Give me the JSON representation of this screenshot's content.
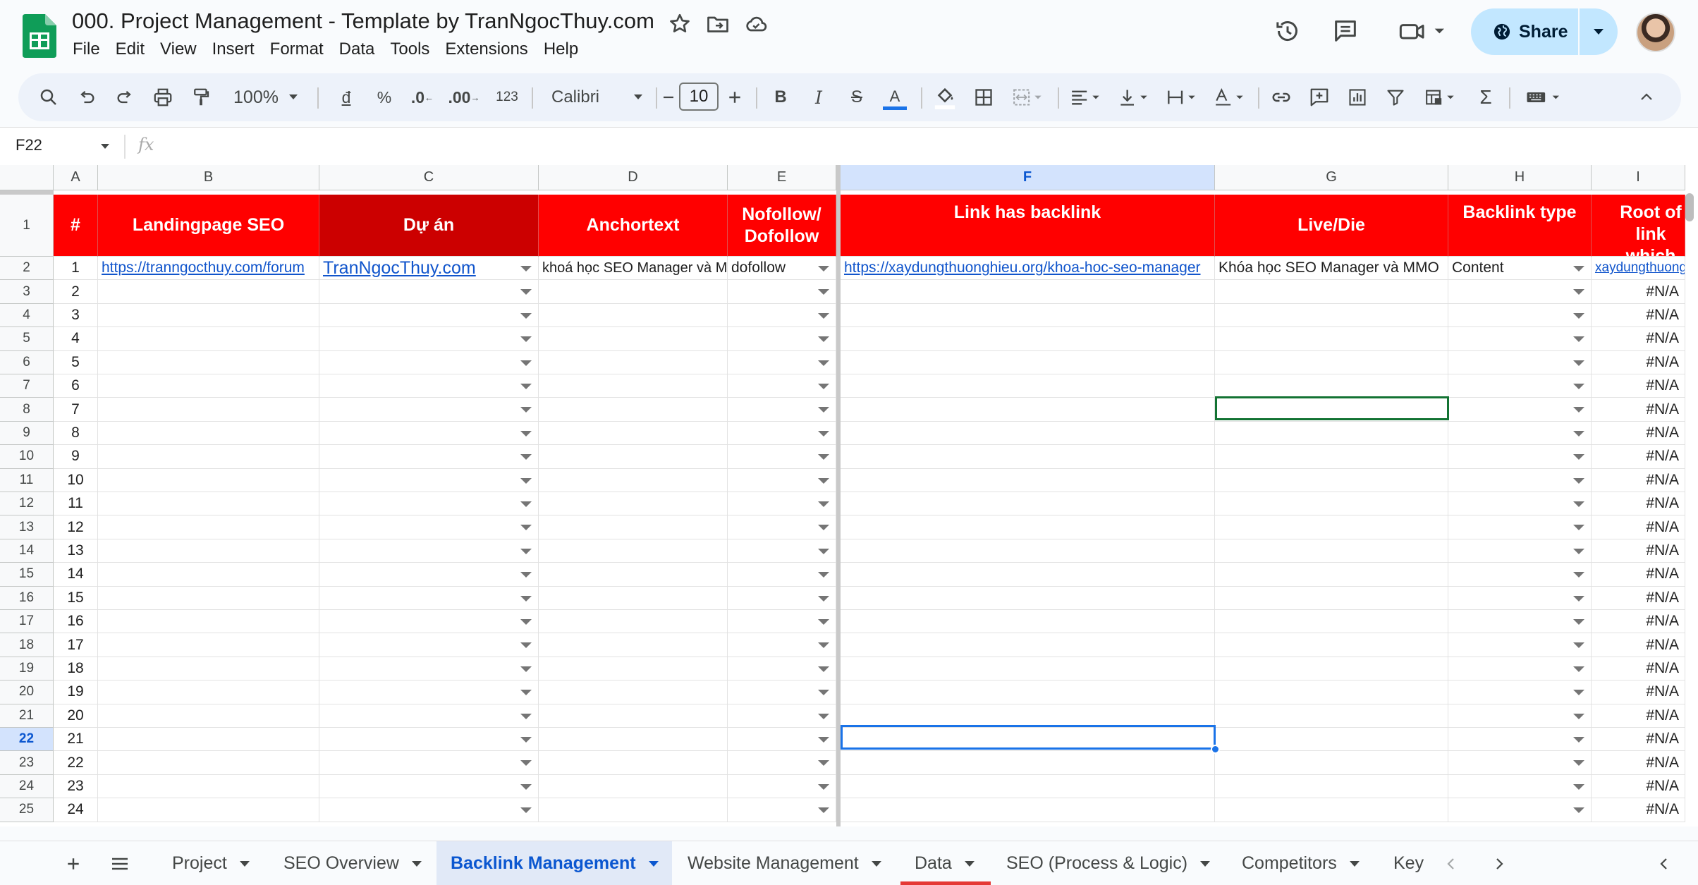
{
  "header": {
    "doc_title": "000. Project Management - Template by TranNgocThuy.com",
    "menus": [
      "File",
      "Edit",
      "View",
      "Insert",
      "Format",
      "Data",
      "Tools",
      "Extensions",
      "Help"
    ],
    "share_label": "Share"
  },
  "toolbar": {
    "zoom": "100%",
    "currency": "đ",
    "percent": "%",
    "dec_less": ".0",
    "dec_more": ".00",
    "number_format": "123",
    "font": "Calibri",
    "font_size": "10",
    "text_color_letter": "A"
  },
  "formula_bar": {
    "cell_ref": "F22",
    "fx": "fx",
    "content": ""
  },
  "grid": {
    "columns": [
      "A",
      "B",
      "C",
      "D",
      "E",
      "F",
      "G",
      "H",
      "I"
    ],
    "selected_column": "F",
    "selected_row": "22",
    "header_row": {
      "a": "#",
      "b": "Landingpage SEO",
      "c": "Dự án",
      "d": "Anchortext",
      "e": "Nofollow/ Dofollow",
      "f": "Link has backlink",
      "g": "Live/Die",
      "h": "Backlink type",
      "i": "Root of link which has backlink"
    },
    "row_numbers": [
      "1",
      "2",
      "3",
      "4",
      "5",
      "6",
      "7",
      "8",
      "9",
      "10",
      "11",
      "12",
      "13",
      "14",
      "15",
      "16",
      "17",
      "18",
      "19",
      "20",
      "21",
      "22",
      "23",
      "24",
      "25"
    ],
    "first_data_row": {
      "b": "https://tranngocthuy.com/forum",
      "c": "TranNgocThuy.com",
      "d": "khoá học SEO Manager và MMO",
      "e": "dofollow",
      "f": "https://xaydungthuonghieu.org/khoa-hoc-seo-manager",
      "g": "Khóa học SEO Manager và MMO",
      "h": "Content",
      "i": "xaydungthuonghieu.org"
    },
    "index_values": [
      "1",
      "2",
      "3",
      "4",
      "5",
      "6",
      "7",
      "8",
      "9",
      "10",
      "11",
      "12",
      "13",
      "14",
      "15",
      "16",
      "17",
      "18",
      "19",
      "20",
      "21",
      "22",
      "23",
      "24"
    ],
    "na_value": "#N/A"
  },
  "sheet_tabs": {
    "tabs": [
      {
        "label": "Project"
      },
      {
        "label": "SEO Overview"
      },
      {
        "label": "Backlink Management"
      },
      {
        "label": "Website Management"
      },
      {
        "label": "Data"
      },
      {
        "label": "SEO (Process & Logic)"
      },
      {
        "label": "Competitors"
      },
      {
        "label": "Key"
      }
    ],
    "active_tab": "Backlink Management"
  },
  "colors": {
    "header_red": "#ff0000",
    "header_dark_red": "#cc0000",
    "link_blue": "#1155cc",
    "selection_blue": "#1a73e8",
    "share_bg": "#c2e7ff"
  }
}
